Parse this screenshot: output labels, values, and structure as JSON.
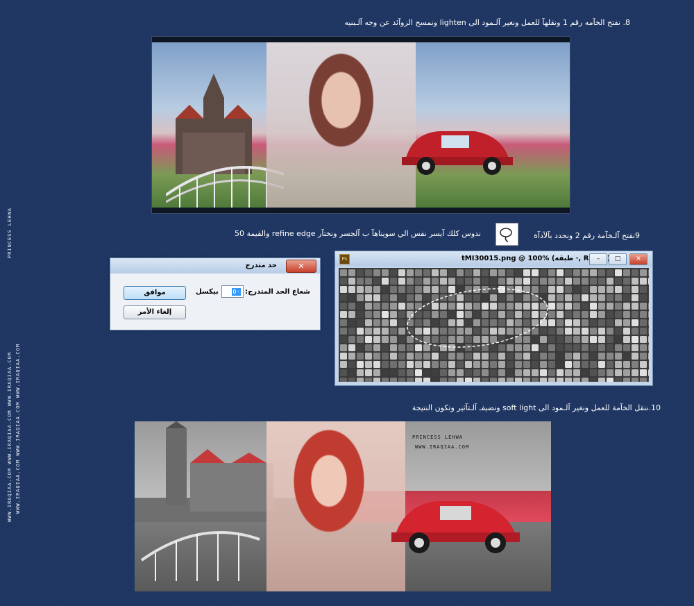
{
  "steps": {
    "step8": "8. نفتح الخآمه رقم 1 ونقلهآ للعمل ونغير آلـمود الى lighten ونمسح الزوآئد عن وجه آلـبنيه",
    "step9a": "9نفتح آلـخآمة رقم 2 ونحدد بآلآدآة",
    "step9b": "ندوس كلك آيسر نفس الي سويناهآ ب آلجسر ونختآر refine edge والقيمة 50",
    "step10": "10.ننقل الخآمة للعمل ونغير آلـمود الى soft light ونضيفـ آلـتآثير وتكون النتيجة"
  },
  "sidebar": {
    "brand": "PRINCESS LEHWA",
    "site_lines": [
      "WWW.IRAQIAA.COM WWW.IRAQIAA.COM WWW.IRAQIAA.COM",
      "WWW.IRAQIAA.COM WWW.IRAQIAA.COM WWW.IRAQIAA.COM"
    ]
  },
  "dialog": {
    "title": "حد متدرج",
    "close": "✕",
    "ok_label": "موافق",
    "cancel_label": "إلغاء الأمر",
    "radius_label": "شعاع الحد المتدرج:",
    "radius_value": "٥٠",
    "unit": "بيكسل"
  },
  "ps_window": {
    "title": "tMI30015.png @ 100% (طبقة ·, RGB/8)",
    "icon": "Ps",
    "minimize": "–",
    "restore": "□",
    "close": "✕"
  },
  "banner2": {
    "watermark_name": "PRINCESS LEHWA",
    "watermark_site": "WWW.IRAQIAA.COM"
  }
}
